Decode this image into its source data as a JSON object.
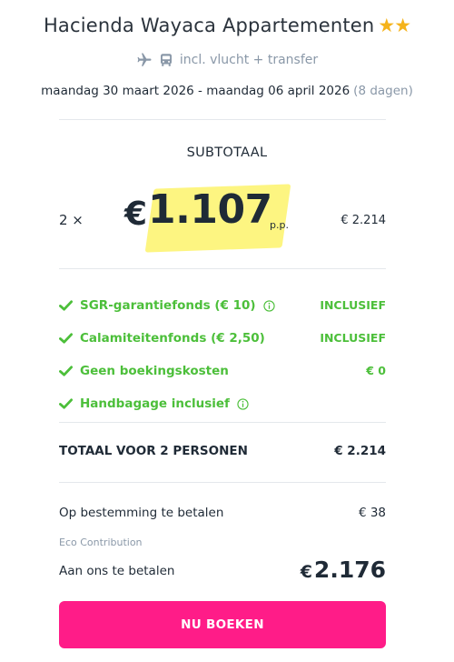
{
  "header": {
    "title": "Hacienda Wayaca Appartementen",
    "stars": "★★",
    "transport_text": "incl. vlucht + transfer",
    "dates": "maandag 30 maart 2026 - maandag 06 april 2026",
    "nights": "(8 dagen)"
  },
  "subtotal": {
    "heading": "SUBTOTAAL",
    "quantity": "2 ×",
    "currency": "€",
    "price_per_person": "1.107",
    "pp_label": "p.p.",
    "line_total": "€ 2.214"
  },
  "features": [
    {
      "label": "SGR-garantiefonds (€ 10)",
      "value": "INCLUSIEF",
      "has_info": true
    },
    {
      "label": "Calamiteitenfonds (€ 2,50)",
      "value": "INCLUSIEF",
      "has_info": false
    },
    {
      "label": "Geen boekingskosten",
      "value": "€ 0",
      "has_info": false
    },
    {
      "label": "Handbagage inclusief",
      "value": "",
      "has_info": true
    }
  ],
  "totals": {
    "total_label": "TOTAAL VOOR 2 PERSONEN",
    "total_value": "€ 2.214",
    "destination_label": "Op bestemming te betalen",
    "destination_value": "€ 38",
    "eco_label": "Eco Contribution",
    "pay_label": "Aan ons te betalen",
    "pay_currency": "€",
    "pay_value": "2.176"
  },
  "cta": {
    "book_label": "NU BOEKEN"
  },
  "colors": {
    "accent": "#ff1c88",
    "success": "#4cbf3a",
    "star": "#f5b31b",
    "highlight": "#fdf47a",
    "muted": "#8a98a8"
  }
}
